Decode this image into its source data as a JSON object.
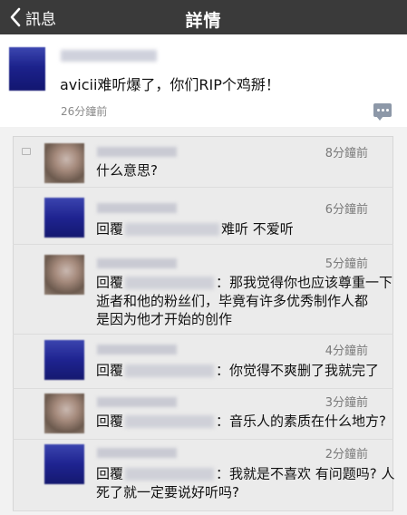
{
  "nav": {
    "back_label": "訊息",
    "title": "詳情"
  },
  "post": {
    "text": "avicii难听爆了，你们RIP个鸡掰！",
    "time": "26分鐘前"
  },
  "replies": [
    {
      "avatar": "brown",
      "time": "8分鐘前",
      "prefix": "",
      "line1": "什么意思?",
      "line2": "",
      "line3": ""
    },
    {
      "avatar": "blue",
      "time": "6分鐘前",
      "prefix": "回覆",
      "line1": "难听 不爱听",
      "line2": "",
      "line3": ""
    },
    {
      "avatar": "brown",
      "time": "5分鐘前",
      "prefix": "回覆",
      "line1": "：那我觉得你也应该尊重一下",
      "line2": "逝者和他的粉丝们，毕竟有许多优秀制作人都",
      "line3": "是因为他才开始的创作"
    },
    {
      "avatar": "blue",
      "time": "4分鐘前",
      "prefix": "回覆",
      "line1": "：你觉得不爽删了我就完了",
      "line2": "",
      "line3": ""
    },
    {
      "avatar": "brown",
      "time": "3分鐘前",
      "prefix": "回覆",
      "line1": "：音乐人的素质在什么地方?",
      "line2": "",
      "line3": ""
    },
    {
      "avatar": "blue",
      "time": "2分鐘前",
      "prefix": "回覆",
      "line1": "：我就是不喜欢 有问题吗? 人",
      "line2": "死了就一定要说好听吗?",
      "line3": ""
    }
  ]
}
